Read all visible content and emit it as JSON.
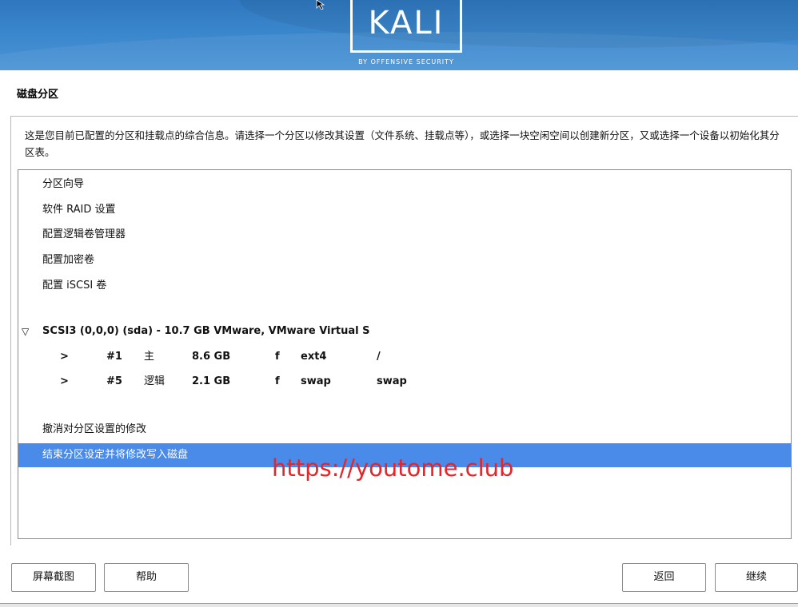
{
  "header": {
    "logo_text": "KALI",
    "logo_subtitle": "BY OFFENSIVE SECURITY",
    "brand_color": "#3a86cc"
  },
  "page": {
    "title": "磁盘分区",
    "description": "这是您目前已配置的分区和挂载点的综合信息。请选择一个分区以修改其设置（文件系统、挂载点等），或选择一块空闲空间以创建新分区，又或选择一个设备以初始化其分区表。"
  },
  "list": {
    "actions": [
      "分区向导",
      "软件 RAID 设置",
      "配置逻辑卷管理器",
      "配置加密卷",
      "配置 iSCSI 卷"
    ],
    "disk": {
      "toggle_icon": "▽",
      "label": "SCSI3 (0,0,0) (sda) - 10.7 GB VMware, VMware Virtual S"
    },
    "partitions": [
      {
        "arrow": ">",
        "number": "#1",
        "type": "主",
        "size": "8.6 GB",
        "flag": "f",
        "fs": "ext4",
        "mount": "/"
      },
      {
        "arrow": ">",
        "number": "#5",
        "type": "逻辑",
        "size": "2.1 GB",
        "flag": "f",
        "fs": "swap",
        "mount": "swap"
      }
    ],
    "undo": "撤消对分区设置的修改",
    "finish": "结束分区设定并将修改写入磁盘",
    "selected_color": "#4a8ae8"
  },
  "watermark": "https://youtome.club",
  "buttons": {
    "screenshot": "屏幕截图",
    "help": "帮助",
    "back": "返回",
    "continue": "继续"
  }
}
